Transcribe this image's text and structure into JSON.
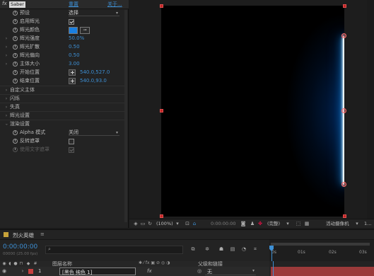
{
  "effect": {
    "fx_label": "fx",
    "name": "Saber",
    "reset_label": "重置",
    "about_label": "关于...",
    "preset": {
      "label": "预设",
      "value": "选择"
    },
    "enable_glow": {
      "label": "启用辉光",
      "checked": true
    },
    "glow_color": {
      "label": "辉光颜色",
      "color": "#1a7fe0"
    },
    "glow_intensity": {
      "label": "辉光强度",
      "value": "50.0%"
    },
    "glow_spread": {
      "label": "辉光扩散",
      "value": "0.50"
    },
    "glow_bias": {
      "label": "辉光偏向",
      "value": "0.50"
    },
    "core_size": {
      "label": "主体大小",
      "value": "3.00"
    },
    "start_pos": {
      "label": "开始位置",
      "value": "540.0,527.0"
    },
    "end_pos": {
      "label": "结束位置",
      "value": "540.0,93.0"
    },
    "groups": [
      "自定义主体",
      "闪烁",
      "失真",
      "辉光设置",
      "渲染设置"
    ],
    "alpha_mode": {
      "label": "Alpha 模式",
      "value": "关闭"
    },
    "invert_mask": {
      "label": "反转遮罩",
      "checked": false
    },
    "use_text_alpha": {
      "label": "使用文字遮罩",
      "checked": true
    }
  },
  "viewer": {
    "zoom": "(100%)",
    "timecode": "0:00:00:00",
    "resolution": "(完整)",
    "camera": "活动摄像机",
    "views": "1..."
  },
  "timeline": {
    "comp_name": "烈火英雄",
    "menu_glyph": "≡",
    "current_time": "0:00:00:00",
    "frame_info": "00000 (25.00 fps)",
    "search_placeholder": "",
    "col_layer_name": "图层名称",
    "col_parent": "父级和链接",
    "ruler_marks": [
      "0s",
      "01s",
      "02s",
      "03s"
    ],
    "layer": {
      "index": "1",
      "name": "[黑色 纯色 1]",
      "parent": "无",
      "label_color": "#c63f3f",
      "fx": "fx"
    }
  }
}
